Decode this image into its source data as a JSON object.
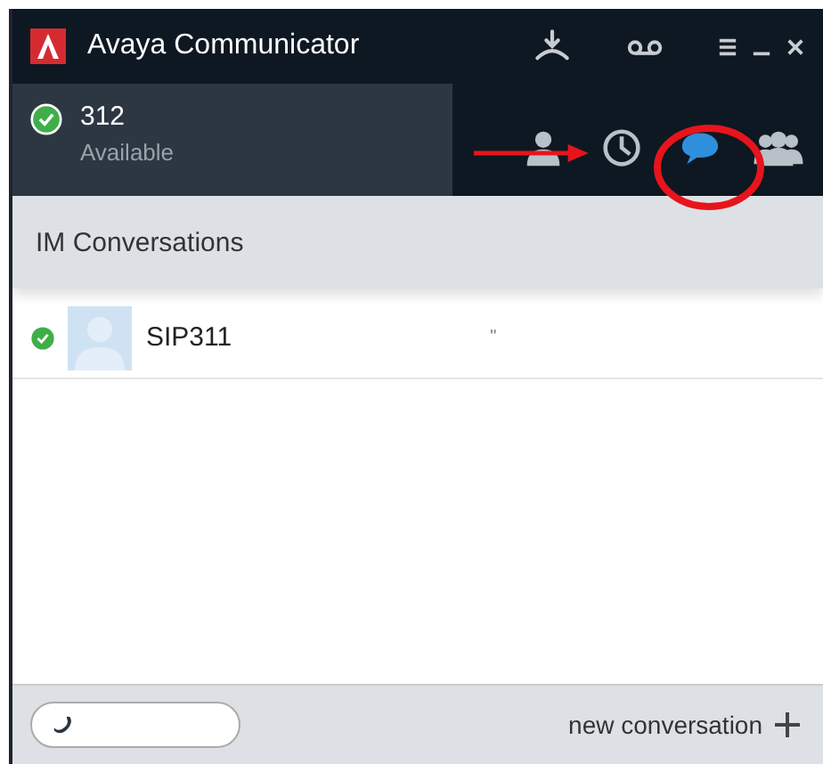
{
  "window": {
    "title": "Avaya Communicator"
  },
  "status": {
    "extension": "312",
    "presence": "Available",
    "online": true
  },
  "tabs": [
    {
      "kind": "contacts",
      "selected": false
    },
    {
      "kind": "history",
      "selected": false
    },
    {
      "kind": "messages",
      "selected": true
    },
    {
      "kind": "groups",
      "selected": false
    }
  ],
  "section": {
    "title": "IM Conversations"
  },
  "conversations": [
    {
      "name": "SIP311",
      "preview": "\"",
      "online": true
    }
  ],
  "footer": {
    "action": "new conversation"
  }
}
